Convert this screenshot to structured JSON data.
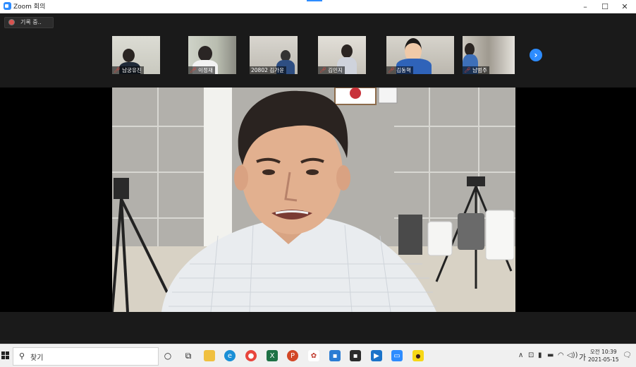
{
  "window": {
    "title": "Zoom 회의",
    "minimize_glyph": "–",
    "maximize_glyph": "☐",
    "close_glyph": "✕"
  },
  "recording": {
    "label": "기록 중.."
  },
  "participants": [
    {
      "name": "남궁유진",
      "muted": true
    },
    {
      "name": "이정재",
      "muted": true
    },
    {
      "name": "20802 김가윤",
      "muted": false
    },
    {
      "name": "김민지",
      "muted": true
    },
    {
      "name": "김동혁",
      "muted": true
    },
    {
      "name": "남범주",
      "muted": true
    }
  ],
  "thumbnail_nav": {
    "glyph": "›"
  },
  "taskbar": {
    "search_placeholder": "찾기",
    "search_icon": "search-icon",
    "ime_indicator": "가",
    "time": "오전 10:39",
    "date": "2021-05-15"
  },
  "colors": {
    "zoom_blue": "#2D8CFF",
    "mute_red": "#e8453c"
  }
}
